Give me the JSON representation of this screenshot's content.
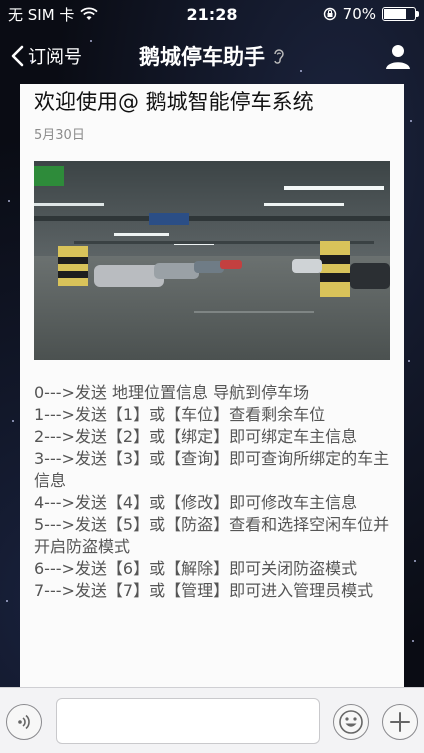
{
  "status_bar": {
    "carrier": "无 SIM 卡",
    "time": "21:28",
    "battery_percent": "70%",
    "battery_level": 0.7
  },
  "nav": {
    "back_label": "订阅号",
    "title": "鹅城停车助手"
  },
  "article": {
    "title": "欢迎使用@ 鹅城智能停车系统",
    "date": "5月30日",
    "lines": [
      "0--->发送 地理位置信息 导航到停车场",
      "1--->发送【1】或【车位】查看剩余车位",
      "2--->发送【2】或【绑定】即可绑定车主信息",
      "3--->发送【3】或【查询】即可查询所绑定的车主信息",
      "4--->发送【4】或【修改】即可修改车主信息",
      "5--->发送【5】或【防盗】查看和选择空闲车位并开启防盗模式",
      "6--->发送【6】或【解除】即可关闭防盗模式",
      "7--->发送【7】或【管理】即可进入管理员模式"
    ]
  },
  "colors": {
    "nav_text": "#ffffff",
    "card_bg": "#fbfbfb",
    "body_text": "#555555",
    "date_text": "#8c8c8c"
  }
}
